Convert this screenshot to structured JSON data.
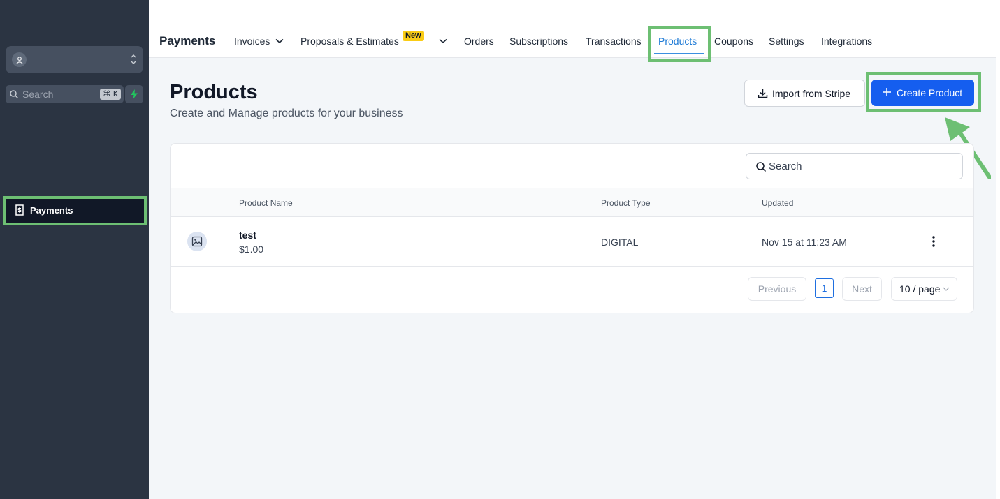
{
  "sidebar": {
    "search_placeholder": "Search",
    "shortcut": "⌘ K",
    "items": [
      {
        "label": "Payments",
        "icon": "receipt-icon"
      }
    ]
  },
  "topnav": {
    "title": "Payments",
    "tabs": [
      {
        "label": "Invoices",
        "dropdown": true
      },
      {
        "label": "Proposals & Estimates",
        "badge": "New",
        "dropdown": true
      },
      {
        "label": "Orders"
      },
      {
        "label": "Subscriptions"
      },
      {
        "label": "Transactions"
      },
      {
        "label": "Products",
        "active": true
      },
      {
        "label": "Coupons"
      },
      {
        "label": "Settings"
      },
      {
        "label": "Integrations"
      }
    ]
  },
  "page": {
    "title": "Products",
    "subtitle": "Create and Manage products for your business",
    "import_label": "Import from Stripe",
    "create_label": "Create Product"
  },
  "table": {
    "search_placeholder": "Search",
    "columns": [
      "Product Name",
      "Product Type",
      "Updated"
    ],
    "rows": [
      {
        "name": "test",
        "price": "$1.00",
        "type": "DIGITAL",
        "updated": "Nov 15 at 11:23 AM"
      }
    ]
  },
  "pagination": {
    "previous": "Previous",
    "current": "1",
    "next": "Next",
    "page_size": "10 / page"
  },
  "colors": {
    "highlight": "#6dbf73",
    "primary": "#155eef",
    "sidebar_bg": "#2b3442",
    "badge": "#facc15"
  }
}
